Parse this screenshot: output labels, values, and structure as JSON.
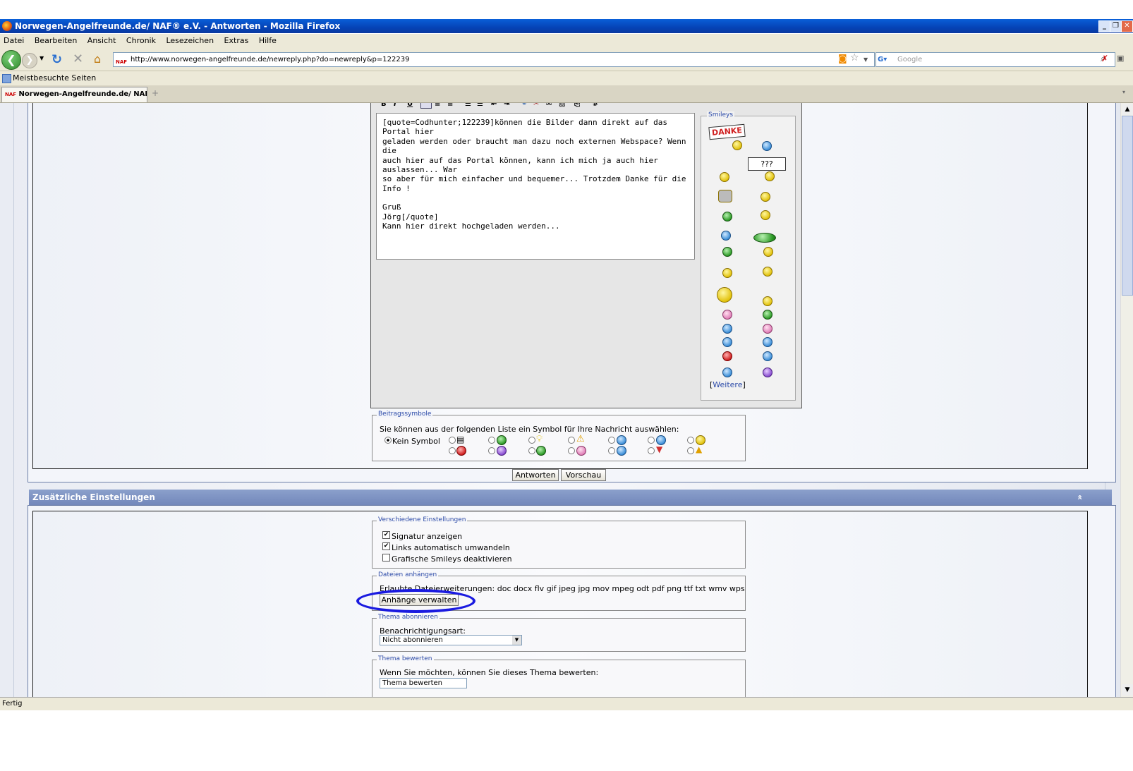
{
  "window": {
    "title": "Norwegen-Angelfreunde.de/ NAF® e.V. - Antworten - Mozilla Firefox",
    "minimize": "_",
    "restore": "❐",
    "close": "✕"
  },
  "menu": [
    "Datei",
    "Bearbeiten",
    "Ansicht",
    "Chronik",
    "Lesezeichen",
    "Extras",
    "Hilfe"
  ],
  "nav": {
    "url": "http://www.norwegen-angelfreunde.de/newreply.php?do=newreply&p=122239",
    "favicon": "NAF",
    "search_placeholder": "Google"
  },
  "bookmarks": {
    "most_visited": "Meistbesuchte Seiten"
  },
  "tab": {
    "label": "Norwegen-Angelfreunde.de/ NAF® e...."
  },
  "editor": {
    "toolbar": [
      "B",
      "I",
      "U"
    ],
    "text_lines": [
      "[quote=Codhunter;122239]können die Bilder dann direkt auf das Portal hier",
      "geladen werden oder braucht man dazu noch externen Webspace? Wenn die",
      "auch hier auf das Portal können, kann ich mich ja auch hier auslassen... War",
      "so aber für mich einfacher und bequemer... Trotzdem Danke für die Info !",
      "",
      "Gruß",
      "Jörg[/quote]",
      "Kann hier direkt hochgeladen werden..."
    ]
  },
  "smileys": {
    "legend": "Smileys",
    "danke": "DANKE",
    "question": "???",
    "more_open": "[",
    "more": "Weitere",
    "more_close": "]"
  },
  "post_icons": {
    "legend": "Beitragssymbole",
    "description": "Sie können aus der folgenden Liste ein Symbol für Ihre Nachricht auswählen:",
    "none_label": "Kein Symbol"
  },
  "buttons": {
    "submit": "Antworten",
    "preview": "Vorschau"
  },
  "additional": {
    "header": "Zusätzliche Einstellungen",
    "collapse": "«",
    "misc_legend": "Verschiedene Einstellungen",
    "signature": "Signatur anzeigen",
    "auto_links": "Links automatisch umwandeln",
    "disable_smileys": "Grafische Smileys deaktivieren",
    "attach_legend": "Dateien anhängen",
    "allowed_ext": "Erlaubte Dateierweiterungen: doc docx flv gif jpeg jpg mov mpeg odt pdf png ttf txt wmv wps",
    "manage_attachments": "Anhänge verwalten",
    "subscribe_legend": "Thema abonnieren",
    "notify_label": "Benachrichtigungsart:",
    "notify_value": "Nicht abonnieren",
    "rate_legend": "Thema bewerten",
    "rate_label": "Wenn Sie möchten, können Sie dieses Thema bewerten:",
    "rate_value": "Thema bewerten"
  },
  "status": {
    "text": "Fertig"
  },
  "annotation": {
    "color": "#1a1ae0"
  }
}
